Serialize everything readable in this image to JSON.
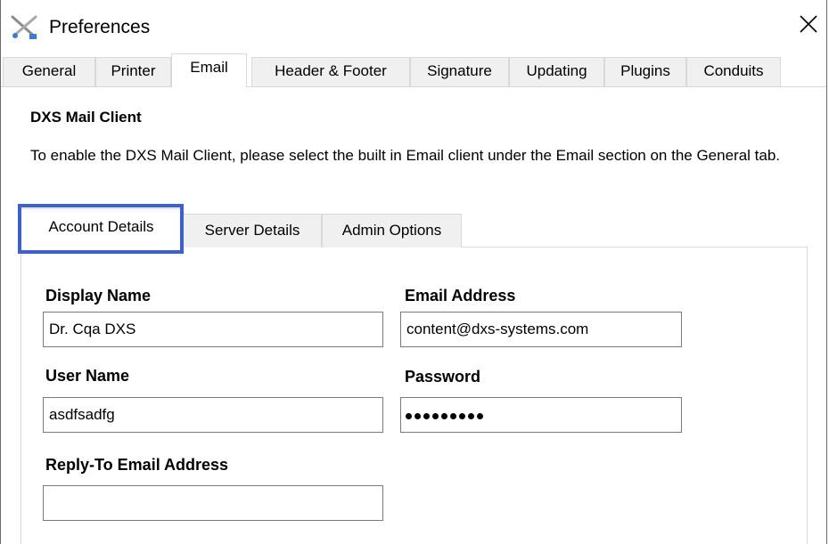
{
  "window": {
    "title": "Preferences",
    "app_icon": "tools-icon",
    "close_icon": "close-icon"
  },
  "main_tabs": [
    {
      "label": "General"
    },
    {
      "label": "Printer"
    },
    {
      "label": "Email",
      "active": true
    },
    {
      "label": "Header & Footer"
    },
    {
      "label": "Signature"
    },
    {
      "label": "Updating"
    },
    {
      "label": "Plugins"
    },
    {
      "label": "Conduits"
    }
  ],
  "section": {
    "heading": "DXS Mail Client",
    "description": "To enable the DXS Mail Client, please select the built in Email client under the Email section on the General tab."
  },
  "sub_tabs": [
    {
      "label": "Account Details",
      "active": true
    },
    {
      "label": "Server Details"
    },
    {
      "label": "Admin Options"
    }
  ],
  "form": {
    "display_name": {
      "label": "Display Name",
      "value": "Dr. Cqa DXS"
    },
    "email_address": {
      "label": "Email Address",
      "value": "content@dxs-systems.com"
    },
    "user_name": {
      "label": "User Name",
      "value": "asdfsadfg"
    },
    "password": {
      "label": "Password",
      "masked_length": 9
    },
    "reply_to": {
      "label": "Reply-To Email Address",
      "value": ""
    }
  },
  "colors": {
    "focus_outline": "#3c5fd6",
    "tab_inactive": "#f0f0f0",
    "border": "#d9d9d9"
  }
}
